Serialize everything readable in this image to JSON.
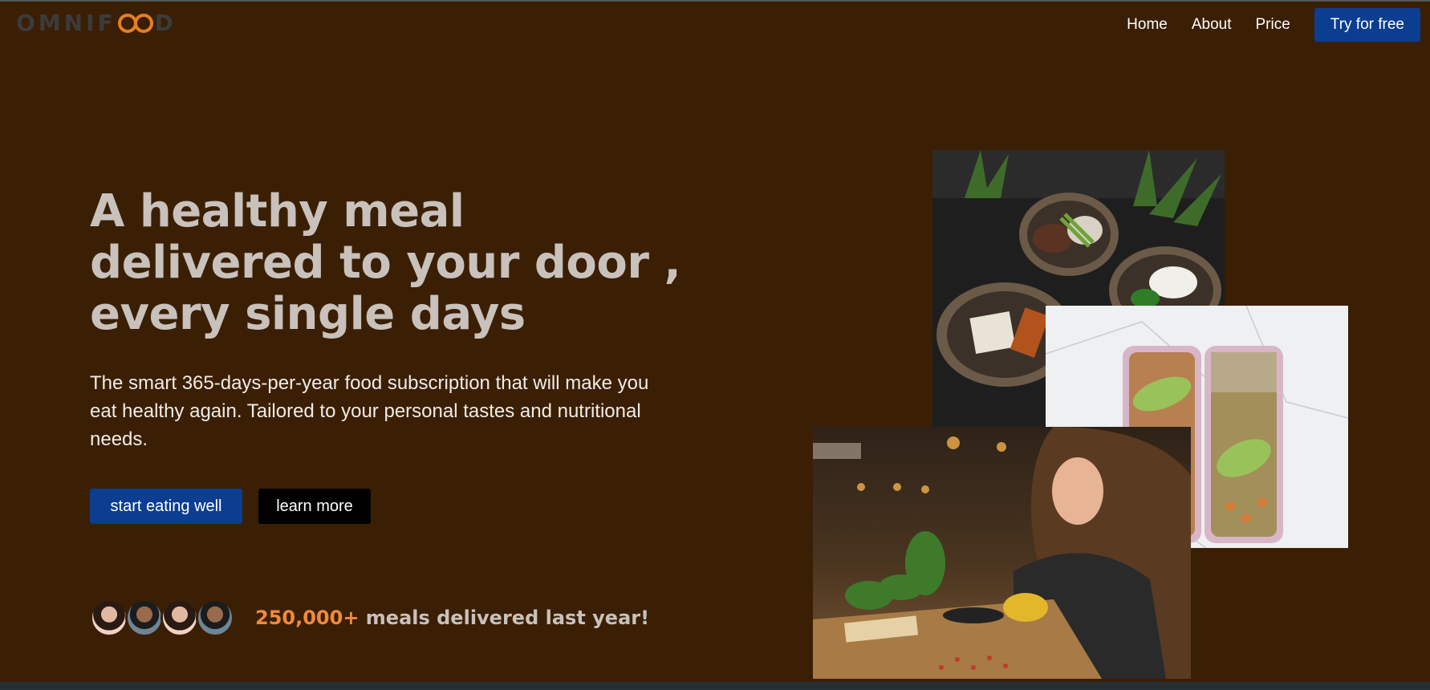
{
  "header": {
    "logo_text_left": "OMNIF",
    "logo_text_right": "D",
    "nav": [
      "Home",
      "About",
      "Price"
    ],
    "cta_label": "Try for free"
  },
  "hero": {
    "title_line1": "A healthy meal",
    "title_line2": "delivered to your door ,",
    "title_line3": "every single days",
    "description": "The smart 365-days-per-year food subscription that will make you eat healthy again. Tailored to your personal tastes and nutritional needs.",
    "primary_button": "start eating well",
    "secondary_button": "learn more"
  },
  "delivered": {
    "count": "250,000+",
    "text": "meals delivered last year!"
  },
  "colors": {
    "background": "#3a1f05",
    "primary_blue": "#0b3d91",
    "accent_orange": "#f08a3c",
    "title_gray": "#c9c1bb"
  }
}
